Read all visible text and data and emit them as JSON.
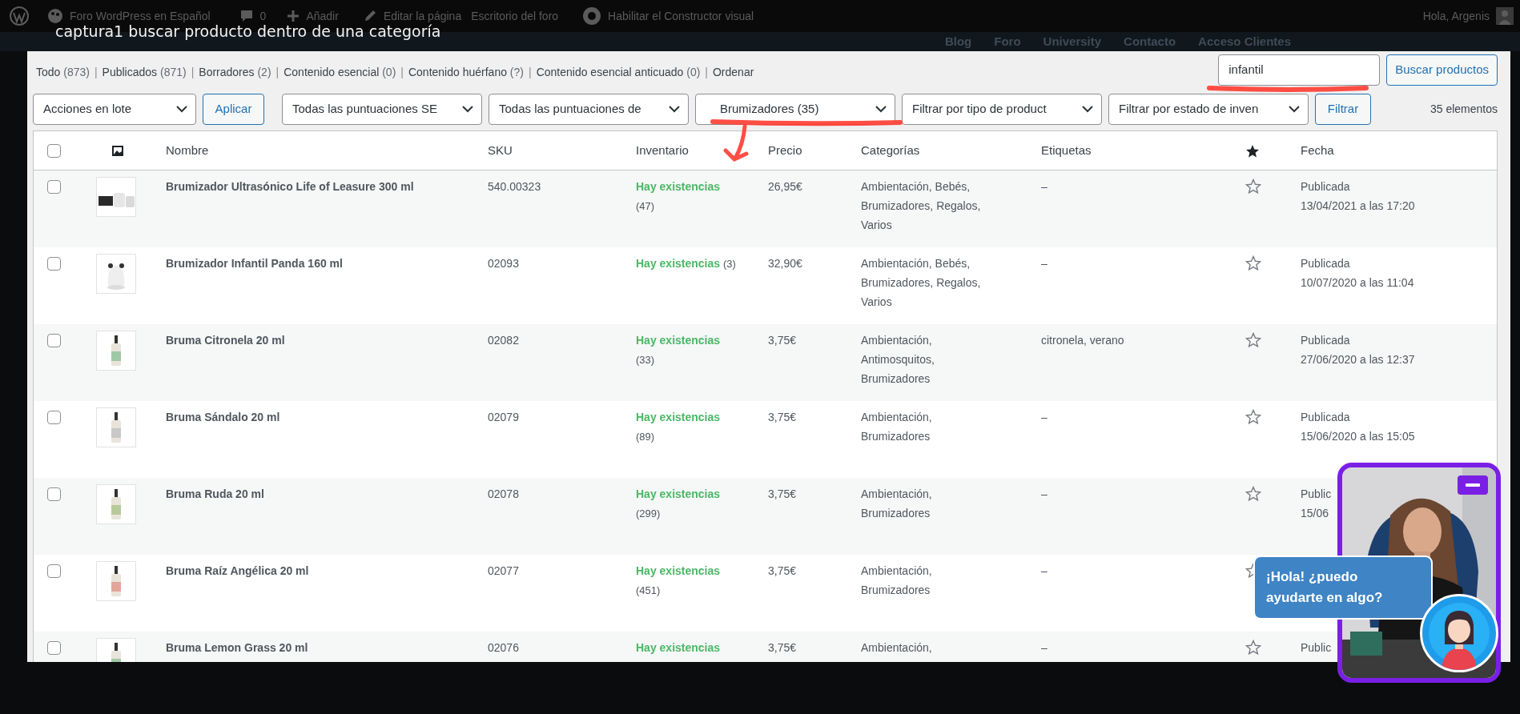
{
  "admin_bar": {
    "site": "Foro WordPress en Español",
    "comments": "0",
    "new": "Añadir",
    "edit": "Editar la página",
    "dashboard": "Escritorio del foro",
    "builder": "Habilitar el Constructor visual",
    "greeting": "Hola, Argenis"
  },
  "site_nav": [
    "Blog",
    "Foro",
    "University",
    "Contacto",
    "Acceso Clientes"
  ],
  "caption": "captura1 buscar producto dentro de una categoría",
  "status_filters": {
    "separator": "|",
    "items": [
      {
        "label": "Todo",
        "count": "(873)"
      },
      {
        "label": "Publicados",
        "count": "(871)"
      },
      {
        "label": "Borradores",
        "count": "(2)"
      },
      {
        "label": "Contenido esencial",
        "count": "(0)"
      },
      {
        "label": "Contenido huérfano",
        "count": "(?)"
      },
      {
        "label": "Contenido esencial anticuado",
        "count": "(0)"
      },
      {
        "label": "Ordenar"
      }
    ]
  },
  "search": {
    "value": "infantil",
    "button": "Buscar productos"
  },
  "bulk_actions": {
    "select": "Acciones en lote",
    "apply": "Aplicar"
  },
  "filters": [
    "Todas las puntuaciones SE",
    "Todas las puntuaciones de",
    "Brumizadores  (35)",
    "Filtrar por tipo de product",
    "Filtrar por estado de inven"
  ],
  "filter_button": "Filtrar",
  "item_count": "35 elementos",
  "table": {
    "select_all_checked": false,
    "columns": [
      "Nombre",
      "SKU",
      "Inventario",
      "Precio",
      "Categorías",
      "Etiquetas",
      "Fecha"
    ],
    "rows": [
      {
        "checked": false,
        "name": "Brumizador Ultrasónico Life of Leasure 300 ml",
        "sku": "540.00323",
        "stock": "Hay existencias",
        "qty": "(47)",
        "price": "26,95€",
        "categories": "Ambientación, Bebés, Brumizadores, Regalos, Varios",
        "tags": "–",
        "featured": false,
        "status": "Publicada",
        "date": "13/04/2021 a las 17:20"
      },
      {
        "checked": false,
        "name": "Brumizador Infantil Panda 160 ml",
        "sku": "02093",
        "stock": "Hay existencias",
        "qty": "(3)",
        "price": "32,90€",
        "categories": "Ambientación, Bebés, Brumizadores, Regalos, Varios",
        "tags": "–",
        "featured": false,
        "status": "Publicada",
        "date": "10/07/2020 a las 11:04"
      },
      {
        "checked": false,
        "name": "Bruma Citronela 20 ml",
        "sku": "02082",
        "stock": "Hay existencias",
        "qty": "(33)",
        "price": "3,75€",
        "categories": "Ambientación, Antimosquitos, Brumizadores",
        "tags": "citronela, verano",
        "featured": false,
        "status": "Publicada",
        "date": "27/06/2020 a las 12:37"
      },
      {
        "checked": false,
        "name": "Bruma Sándalo 20 ml",
        "sku": "02079",
        "stock": "Hay existencias",
        "qty": "(89)",
        "price": "3,75€",
        "categories": "Ambientación, Brumizadores",
        "tags": "–",
        "featured": false,
        "status": "Publicada",
        "date": "15/06/2020 a las 15:05"
      },
      {
        "checked": false,
        "name": "Bruma Ruda 20 ml",
        "sku": "02078",
        "stock": "Hay existencias",
        "qty": "(299)",
        "price": "3,75€",
        "categories": "Ambientación, Brumizadores",
        "tags": "–",
        "featured": false,
        "status": "Public",
        "date": "15/06"
      },
      {
        "checked": false,
        "name": "Bruma Raíz Angélica 20 ml",
        "sku": "02077",
        "stock": "Hay existencias",
        "qty": "(451)",
        "price": "3,75€",
        "categories": "Ambientación, Brumizadores",
        "tags": "–",
        "featured": false
      },
      {
        "checked": false,
        "name": "Bruma Lemon Grass 20 ml",
        "sku": "02076",
        "stock": "Hay existencias",
        "price": "3,75€",
        "categories": "Ambientación,",
        "tags": "–",
        "featured": false,
        "status": "Public"
      }
    ]
  },
  "chat": {
    "greeting": "¡Hola! ¿puedo ayudarte en algo?"
  }
}
